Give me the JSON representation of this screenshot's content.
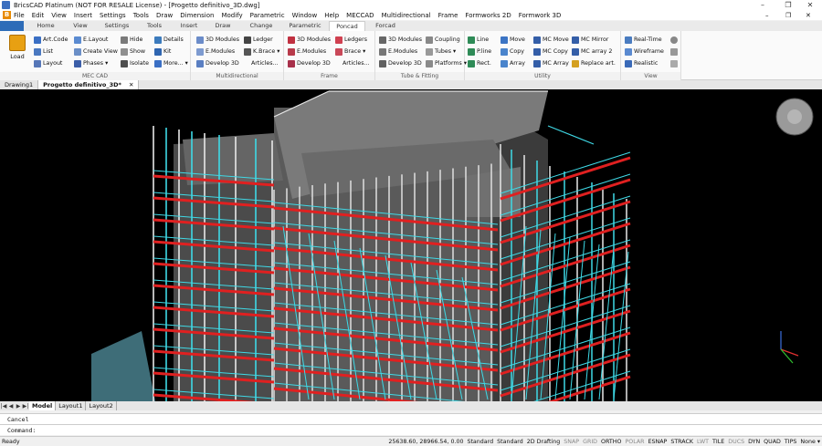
{
  "window": {
    "title": "BricsCAD Platinum (NOT FOR RESALE License) - [Progetto definitivo_3D.dwg]",
    "controls": [
      "–",
      "❐",
      "✕"
    ]
  },
  "menu": {
    "logo": "B",
    "items": [
      "File",
      "Edit",
      "View",
      "Insert",
      "Settings",
      "Tools",
      "Draw",
      "Dimension",
      "Modify",
      "Parametric",
      "Window",
      "Help",
      "MECCAD",
      "Multidirectional",
      "Frame",
      "Formworks 2D",
      "Formwork 3D"
    ],
    "doc_controls": [
      "–",
      "❐",
      "✕"
    ]
  },
  "ribbon_tabs": {
    "file_tab": "",
    "tabs": [
      "Home",
      "View",
      "Settings",
      "Tools",
      "Insert",
      "Draw",
      "Change",
      "Parametric",
      "Poncad",
      "Forcad"
    ],
    "active": "Poncad"
  },
  "ribbon": {
    "load_label": "Load",
    "groups": [
      {
        "label": "MEC CAD",
        "buttons": [
          "Art.Code",
          "E.Layout",
          "Hide",
          "Details",
          "List",
          "Create View",
          "Show",
          "Kit",
          "Layout",
          "Phases ▾",
          "Isolate",
          "More... ▾"
        ]
      },
      {
        "label": "Multidirectional",
        "buttons": [
          "3D Modules",
          "Ledger",
          "E.Modules",
          "K.Brace ▾",
          "Develop 3D",
          "Articles..."
        ]
      },
      {
        "label": "Frame",
        "buttons": [
          "3D Modules",
          "Ledgers",
          "E.Modules",
          "Brace ▾",
          "Develop 3D",
          "Articles..."
        ]
      },
      {
        "label": "Tube & Fitting",
        "buttons": [
          "3D Modules",
          "Coupling",
          "E.Modules",
          "Tubes ▾",
          "Develop 3D",
          "Platforms ▾"
        ]
      },
      {
        "label": "Utility",
        "buttons": [
          "Line",
          "Move",
          "MC Move",
          "MC Mirror",
          "P.line",
          "Copy",
          "MC Copy",
          "MC array 2",
          "Rect.",
          "Array",
          "MC Array",
          "Replace art."
        ]
      },
      {
        "label": "View",
        "buttons": [
          "Real-Time",
          "Wireframe",
          "Realistic"
        ]
      }
    ]
  },
  "document_tabs": {
    "tabs": [
      "Drawing1",
      "Progetto definitivo_3D*"
    ],
    "close_glyph": "✕"
  },
  "viewport": {
    "background": "#000000",
    "scaffold_white": "#e8e8e8",
    "scaffold_cyan": "#3fd9e6",
    "ledger_red": "#e02020",
    "building_gray": "#5a5a5a"
  },
  "layout_tabs": {
    "nav": [
      "|◀",
      "◀",
      "▶",
      "▶|"
    ],
    "tabs": [
      "Model",
      "Layout1",
      "Layout2"
    ]
  },
  "command": {
    "history": "Cancel",
    "prompt": "Command:",
    "value": ""
  },
  "status": {
    "ready": "Ready",
    "coords": "25638.60, 28966.54, 0.00",
    "items": [
      {
        "label": "Standard",
        "on": true
      },
      {
        "label": "Standard",
        "on": true
      },
      {
        "label": "2D Drafting",
        "on": true
      },
      {
        "label": "SNAP",
        "on": false
      },
      {
        "label": "GRID",
        "on": false
      },
      {
        "label": "ORTHO",
        "on": true
      },
      {
        "label": "POLAR",
        "on": false
      },
      {
        "label": "ESNAP",
        "on": true
      },
      {
        "label": "STRACK",
        "on": true
      },
      {
        "label": "LWT",
        "on": false
      },
      {
        "label": "TILE",
        "on": true
      },
      {
        "label": "DUCS",
        "on": false
      },
      {
        "label": "DYN",
        "on": true
      },
      {
        "label": "QUAD",
        "on": true
      },
      {
        "label": "TIPS",
        "on": true
      },
      {
        "label": "None ▾",
        "on": true
      }
    ]
  }
}
